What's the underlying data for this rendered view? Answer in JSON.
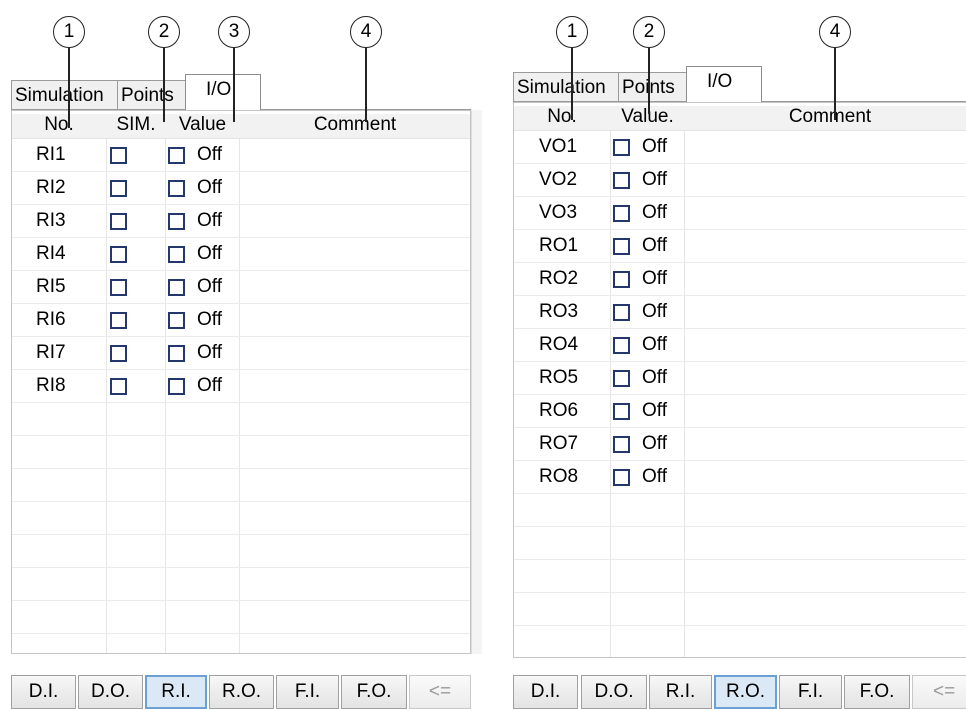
{
  "left": {
    "callouts": [
      "1",
      "2",
      "3",
      "4"
    ],
    "tabs": [
      "Simulation",
      "Points",
      "I/O"
    ],
    "headers": {
      "no": "No.",
      "sim": "SIM.",
      "value": "Value",
      "comment": "Comment"
    },
    "rows": [
      {
        "no": "RI1",
        "value": "Off"
      },
      {
        "no": "RI2",
        "value": "Off"
      },
      {
        "no": "RI3",
        "value": "Off"
      },
      {
        "no": "RI4",
        "value": "Off"
      },
      {
        "no": "RI5",
        "value": "Off"
      },
      {
        "no": "RI6",
        "value": "Off"
      },
      {
        "no": "RI7",
        "value": "Off"
      },
      {
        "no": "RI8",
        "value": "Off"
      }
    ],
    "buttons": [
      "D.I.",
      "D.O.",
      "R.I.",
      "R.O.",
      "F.I.",
      "F.O.",
      "<="
    ],
    "selected_button": "R.I."
  },
  "right": {
    "callouts": [
      "1",
      "2",
      "4"
    ],
    "tabs": [
      "Simulation",
      "Points",
      "I/O"
    ],
    "headers": {
      "no": "No.",
      "value": "Value.",
      "comment": "Comment"
    },
    "rows": [
      {
        "no": "VO1",
        "value": "Off"
      },
      {
        "no": "VO2",
        "value": "Off"
      },
      {
        "no": "VO3",
        "value": "Off"
      },
      {
        "no": "RO1",
        "value": "Off"
      },
      {
        "no": "RO2",
        "value": "Off"
      },
      {
        "no": "RO3",
        "value": "Off"
      },
      {
        "no": "RO4",
        "value": "Off"
      },
      {
        "no": "RO5",
        "value": "Off"
      },
      {
        "no": "RO6",
        "value": "Off"
      },
      {
        "no": "RO7",
        "value": "Off"
      },
      {
        "no": "RO8",
        "value": "Off"
      }
    ],
    "buttons": [
      "D.I.",
      "D.O.",
      "R.I.",
      "R.O.",
      "F.I.",
      "F.O.",
      "<="
    ],
    "selected_button": "R.O."
  }
}
